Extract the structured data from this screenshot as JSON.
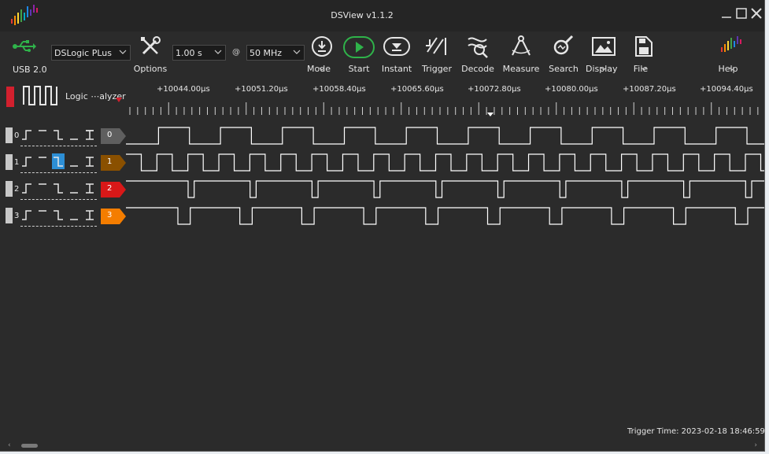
{
  "window": {
    "title": "DSView v1.1.2"
  },
  "toolbar": {
    "usb_label": "USB 2.0",
    "device": "DSLogic PLus",
    "options_label": "Options",
    "sample_time": "1.00 s",
    "at_symbol": "@",
    "sample_rate": "50 MHz",
    "mode_label": "Mode",
    "start_label": "Start",
    "instant_label": "Instant",
    "trigger_label": "Trigger",
    "decode_label": "Decode",
    "measure_label": "Measure",
    "search_label": "Search",
    "display_label": "Display",
    "file_label": "File",
    "help_label": "Help"
  },
  "mode_selector": {
    "label": "Logic ⋯alyzer"
  },
  "ruler": {
    "labels": [
      "+10044.00µs",
      "+10051.20µs",
      "+10058.40µs",
      "+10065.60µs",
      "+10072.80µs",
      "+10080.00µs",
      "+10087.20µs",
      "+10094.40µs"
    ]
  },
  "channels": [
    {
      "num": "0",
      "tag": "0",
      "color": "#5f5f5f",
      "text_color": "#ffffff"
    },
    {
      "num": "1",
      "tag": "1",
      "color": "#8a5000",
      "text_color": "#ffffff"
    },
    {
      "num": "2",
      "tag": "2",
      "color": "#d81818",
      "text_color": "#ffffff"
    },
    {
      "num": "3",
      "tag": "3",
      "color": "#f47d00",
      "text_color": "#ffffff"
    }
  ],
  "status": {
    "trigger_time": "Trigger Time: 2023-02-18 18:46:59"
  },
  "colors": {
    "background": "#2b2b2b",
    "waveform": "#ffffff",
    "selected_trigger": "#2d8fd6"
  }
}
